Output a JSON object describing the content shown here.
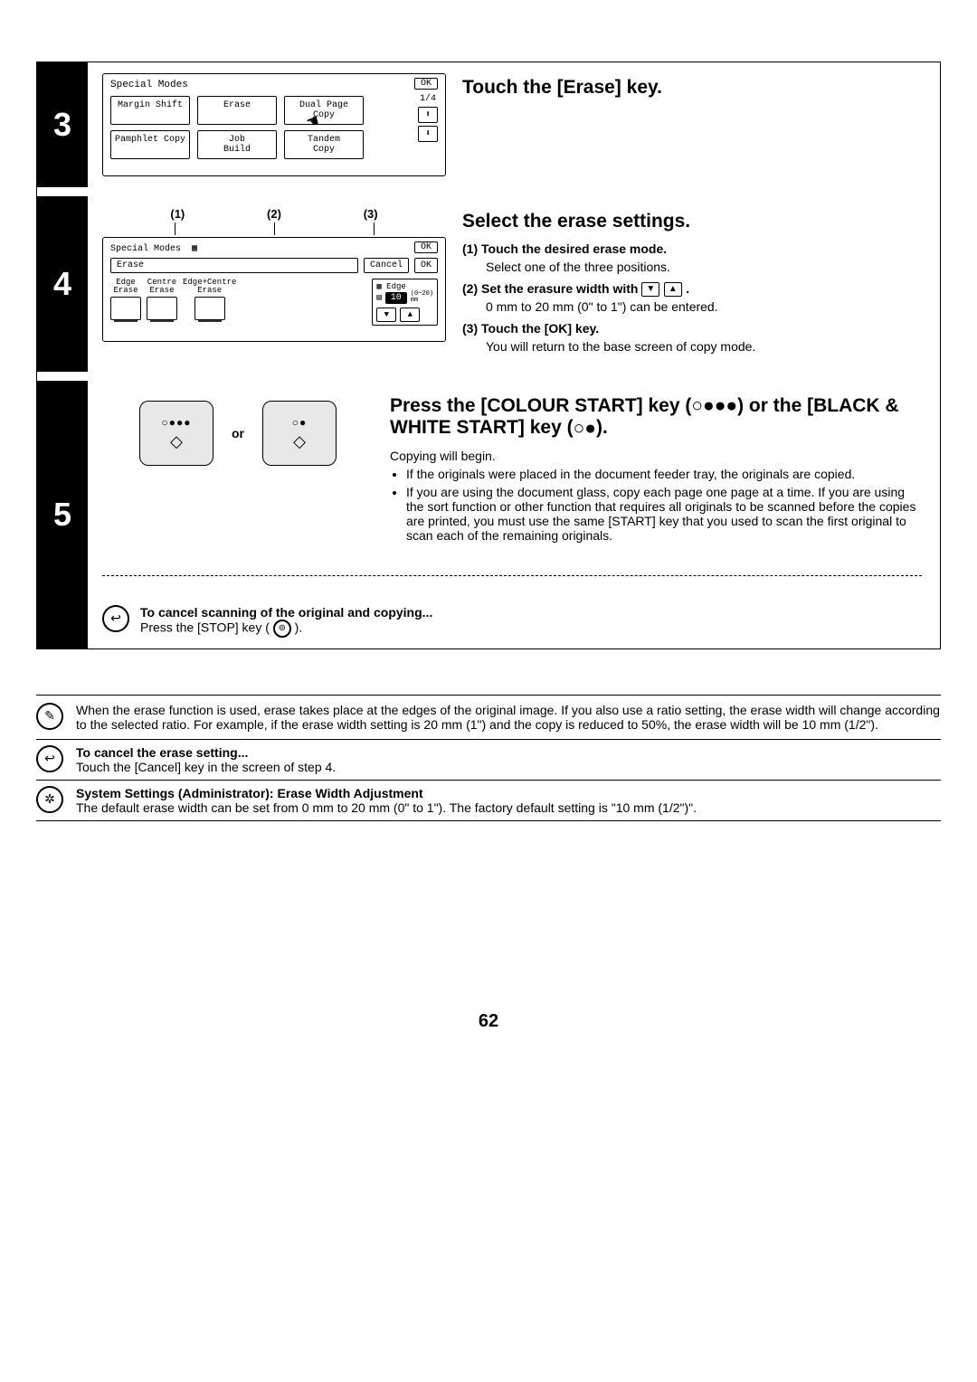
{
  "step3": {
    "num": "3",
    "title": "Touch the [Erase] key.",
    "panel": {
      "title": "Special Modes",
      "ok": "OK",
      "page": "1/4",
      "buttons": [
        "Margin Shift",
        "Erase",
        "Dual Page\nCopy",
        "Pamphlet Copy",
        "Job\nBuild",
        "Tandem\nCopy"
      ]
    }
  },
  "step4": {
    "num": "4",
    "labels": [
      "(1)",
      "(2)",
      "(3)"
    ],
    "panel": {
      "title": "Special Modes",
      "ok": "OK",
      "erase_bar": "Erase",
      "cancel": "Cancel",
      "ok2": "OK",
      "modes": [
        {
          "l1": "Edge",
          "l2": "Erase"
        },
        {
          "l1": "Centre",
          "l2": "Erase"
        },
        {
          "l1": "Edge+Centre",
          "l2": "Erase"
        }
      ],
      "edge_label": "Edge",
      "value": "10",
      "range": "(0~20)\nmm"
    },
    "title": "Select the erase settings.",
    "sub1_h": "(1)  Touch the desired erase mode.",
    "sub1_b": "Select one of the three positions.",
    "sub2_h_a": "(2)  Set the erasure width with ",
    "sub2_h_b": " .",
    "sub2_b": "0 mm to 20 mm (0\" to 1\") can be entered.",
    "sub3_h": "(3)  Touch the [OK] key.",
    "sub3_b": "You will return to the base screen of copy mode."
  },
  "step5": {
    "num": "5",
    "or": "or",
    "title_a": "Press the [COLOUR START] key (",
    "title_b": ") or the [BLACK & WHITE START] key (",
    "title_c": ").",
    "body1": "Copying will begin.",
    "bul1": "If the originals were placed in the document feeder tray, the originals are copied.",
    "bul2": "If you are using the document glass, copy each page one page at a time. If you are using the sort function or other function that requires all originals to be scanned before the copies are printed, you must use the same [START] key that you used to scan the first original to scan each of the remaining originals.",
    "cancel_h": "To cancel scanning of the original and copying...",
    "cancel_b_a": "Press the [STOP] key ( ",
    "cancel_b_b": " )."
  },
  "bottom": {
    "note1": "When the erase function is used, erase takes place at the edges of the original image. If you also use a ratio setting, the erase width will change according to the selected ratio. For example, if the erase width setting is 20 mm (1\") and the copy is reduced to 50%, the erase width will be 10 mm (1/2\").",
    "note2_h": "To cancel the erase setting...",
    "note2_b": "Touch the [Cancel] key in the screen of step 4.",
    "note3_h": "System Settings (Administrator): Erase Width Adjustment",
    "note3_b": "The default erase width can be set from 0 mm to 20 mm (0\" to 1\"). The factory default setting is \"10 mm (1/2\")\"."
  },
  "page_num": "62"
}
